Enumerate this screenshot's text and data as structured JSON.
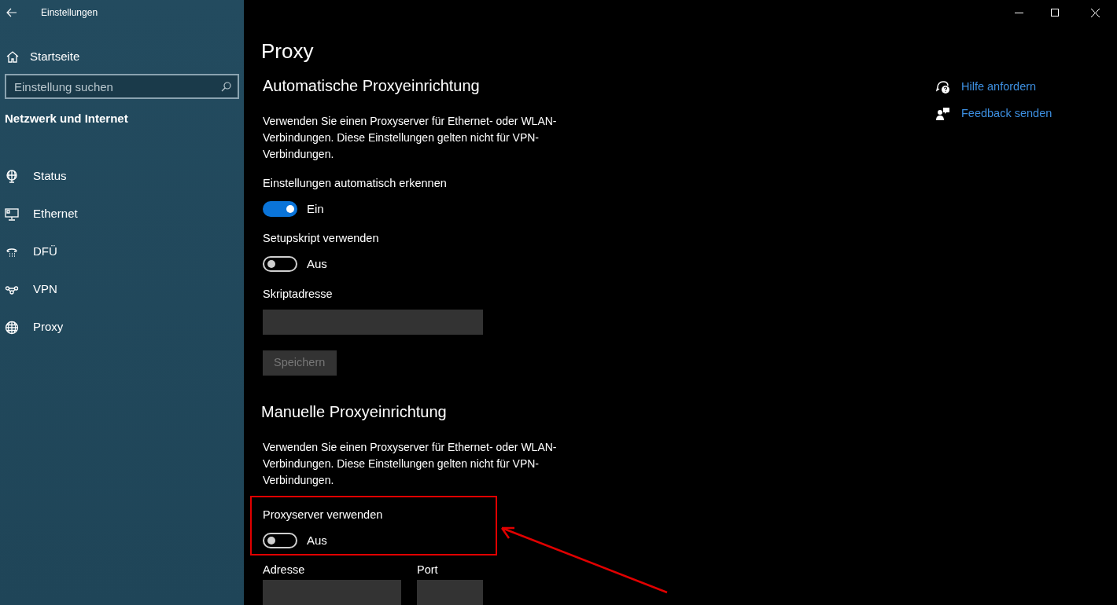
{
  "window": {
    "title": "Einstellungen"
  },
  "sidebar": {
    "home": "Startseite",
    "search": {
      "placeholder": "Einstellung suchen"
    },
    "section": "Netzwerk und Internet",
    "items": [
      {
        "label": "Status",
        "kind": "status"
      },
      {
        "label": "Ethernet",
        "kind": "ethernet"
      },
      {
        "label": "DFÜ",
        "kind": "dialup"
      },
      {
        "label": "VPN",
        "kind": "vpn"
      },
      {
        "label": "Proxy",
        "kind": "proxy"
      }
    ]
  },
  "page": {
    "title": "Proxy",
    "auto": {
      "heading": "Automatische Proxyeinrichtung",
      "description": "Verwenden Sie einen Proxyserver für Ethernet- oder WLAN-Verbindungen. Diese Einstellungen gelten nicht für VPN-Verbindungen.",
      "toggles": [
        {
          "label": "Einstellungen automatisch erkennen",
          "on": true,
          "state": "Ein"
        },
        {
          "label": "Setupskript verwenden",
          "on": false,
          "state": "Aus"
        }
      ],
      "script_address": {
        "label": "Skriptadresse"
      },
      "save": {
        "label": "Speichern",
        "disabled": true
      }
    },
    "manual": {
      "heading": "Manuelle Proxyeinrichtung",
      "description": "Verwenden Sie einen Proxyserver für Ethernet- oder WLAN-Verbindungen. Diese Einstellungen gelten nicht für VPN-Verbindungen.",
      "toggle": {
        "label": "Proxyserver verwenden",
        "on": false,
        "state": "Aus",
        "highlighted": true
      },
      "fields": [
        {
          "label": "Adresse"
        },
        {
          "label": "Port"
        }
      ]
    }
  },
  "links": [
    {
      "label": "Hilfe anfordern",
      "kind": "help"
    },
    {
      "label": "Feedback senden",
      "kind": "feedback"
    }
  ]
}
